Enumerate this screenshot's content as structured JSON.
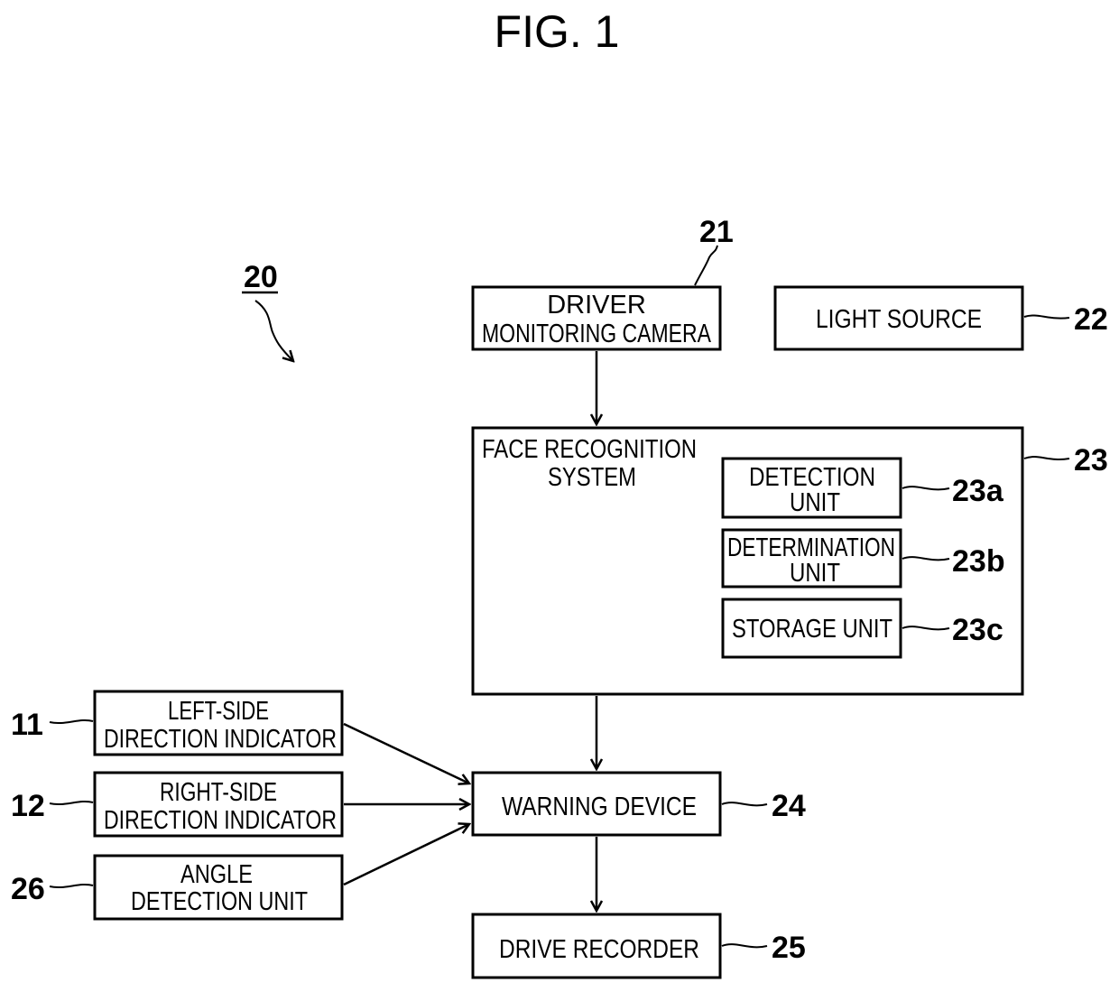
{
  "figure": {
    "title": "FIG. 1",
    "system_ref": "20"
  },
  "blocks": {
    "camera": {
      "ref": "21",
      "lines": [
        "DRIVER",
        "MONITORING CAMERA"
      ]
    },
    "light": {
      "ref": "22",
      "lines": [
        "LIGHT SOURCE"
      ]
    },
    "face": {
      "ref": "23",
      "lines": [
        "FACE RECOGNITION",
        "SYSTEM"
      ]
    },
    "detection": {
      "ref": "23a",
      "lines": [
        "DETECTION",
        "UNIT"
      ]
    },
    "determination": {
      "ref": "23b",
      "lines": [
        "DETERMINATION",
        "UNIT"
      ]
    },
    "storage": {
      "ref": "23c",
      "lines": [
        "STORAGE UNIT"
      ]
    },
    "warning": {
      "ref": "24",
      "lines": [
        "WARNING DEVICE"
      ]
    },
    "recorder": {
      "ref": "25",
      "lines": [
        "DRIVE RECORDER"
      ]
    },
    "left_ind": {
      "ref": "11",
      "lines": [
        "LEFT-SIDE",
        "DIRECTION INDICATOR"
      ]
    },
    "right_ind": {
      "ref": "12",
      "lines": [
        "RIGHT-SIDE",
        "DIRECTION INDICATOR"
      ]
    },
    "angle": {
      "ref": "26",
      "lines": [
        "ANGLE",
        "DETECTION UNIT"
      ]
    }
  },
  "connections": [
    {
      "from": "camera",
      "to": "face"
    },
    {
      "from": "face",
      "to": "warning"
    },
    {
      "from": "left_ind",
      "to": "warning"
    },
    {
      "from": "right_ind",
      "to": "warning"
    },
    {
      "from": "angle",
      "to": "warning"
    },
    {
      "from": "warning",
      "to": "recorder"
    }
  ]
}
